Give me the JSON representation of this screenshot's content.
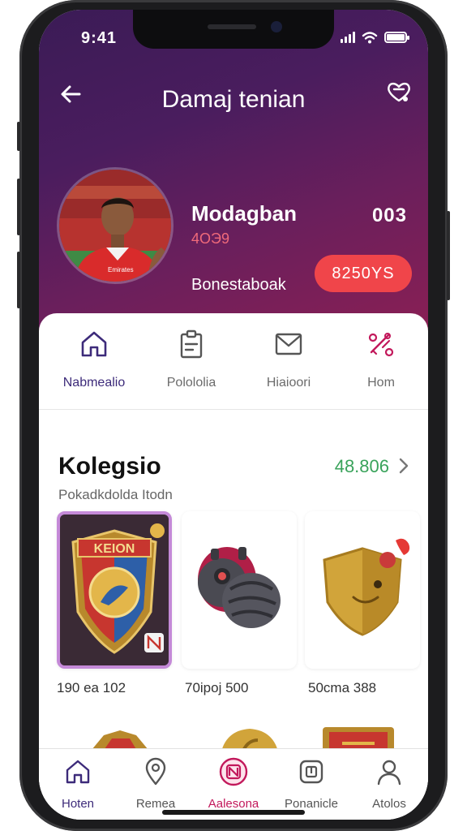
{
  "status": {
    "time": "9:41"
  },
  "header": {
    "title": "Damaj tenian"
  },
  "profile": {
    "name": "Modagban",
    "subtitle": "4ОЭ9",
    "count": "003",
    "label": "Bonestaboak",
    "button_label": "8250YS"
  },
  "quick_nav": [
    {
      "label": "Nabmealio",
      "icon": "home-icon"
    },
    {
      "label": "Polololia",
      "icon": "clipboard-icon"
    },
    {
      "label": "Hiaioori",
      "icon": "mail-icon"
    },
    {
      "label": "Hom",
      "icon": "puzzle-icon"
    }
  ],
  "collection": {
    "title": "Kolegsio",
    "value": "48.806",
    "subtitle": "Pokadkdolda Itodn",
    "items": [
      {
        "caption": "190 ea 102",
        "icon": "crest-badge-icon"
      },
      {
        "caption": "70ipoj 500",
        "icon": "armor-helmet-icon"
      },
      {
        "caption": "50cma 388",
        "icon": "gold-shield-icon"
      }
    ]
  },
  "tabbar": [
    {
      "label": "Hoten",
      "icon": "home-icon"
    },
    {
      "label": "Remea",
      "icon": "location-pin-icon"
    },
    {
      "label": "Aalesona",
      "icon": "badge-icon"
    },
    {
      "label": "Ponanicle",
      "icon": "grid-icon"
    },
    {
      "label": "Atolos",
      "icon": "user-icon"
    }
  ],
  "colors": {
    "accent": "#c2185b",
    "button": "#f0454a",
    "value_green": "#3aa35b",
    "hero_start": "#3b1b56",
    "hero_end": "#8a1f54"
  }
}
